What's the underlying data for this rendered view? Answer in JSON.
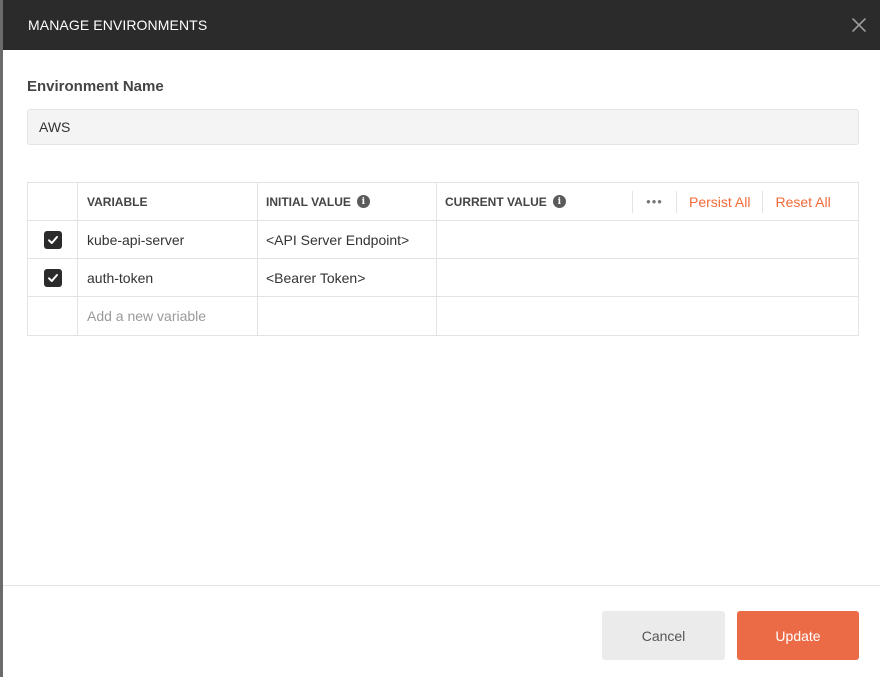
{
  "dialog": {
    "title": "MANAGE ENVIRONMENTS"
  },
  "environment": {
    "label": "Environment Name",
    "value": "AWS"
  },
  "table": {
    "headers": {
      "variable": "VARIABLE",
      "initial_value": "INITIAL VALUE",
      "current_value": "CURRENT VALUE"
    },
    "actions": {
      "more": "•••",
      "persist_all": "Persist All",
      "reset_all": "Reset All"
    },
    "rows": [
      {
        "checked": true,
        "variable": "kube-api-server",
        "initial_value": "<API Server Endpoint>",
        "current_value": ""
      },
      {
        "checked": true,
        "variable": "auth-token",
        "initial_value": "<Bearer Token>",
        "current_value": ""
      }
    ],
    "new_row_placeholder": "Add a new variable"
  },
  "buttons": {
    "cancel": "Cancel",
    "update": "Update"
  },
  "colors": {
    "header_bg": "#2b2b2b",
    "accent": "#f26b3a",
    "update_button": "#ec6b47"
  },
  "icons": {
    "close": "close-icon",
    "info": "info-icon",
    "check": "checkmark-icon",
    "more": "more-dots-icon"
  }
}
